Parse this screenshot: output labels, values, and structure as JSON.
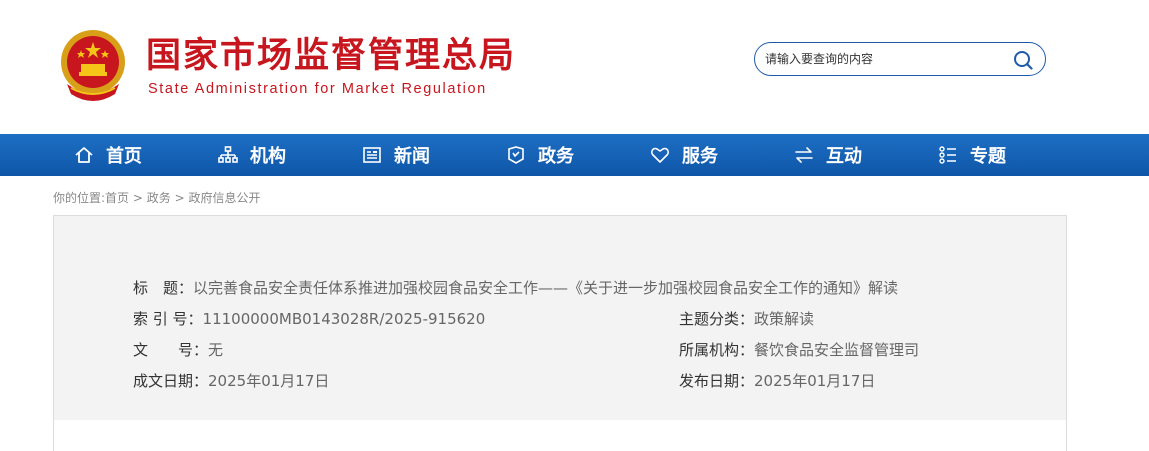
{
  "header": {
    "title": "国家市场监督管理总局",
    "subtitle": "State Administration for Market Regulation",
    "search_placeholder": "请输入要查询的内容"
  },
  "nav": {
    "items": [
      {
        "label": "首页",
        "icon": "home-icon"
      },
      {
        "label": "机构",
        "icon": "org-chart-icon"
      },
      {
        "label": "新闻",
        "icon": "news-icon"
      },
      {
        "label": "政务",
        "icon": "government-affairs-icon"
      },
      {
        "label": "服务",
        "icon": "heart-icon"
      },
      {
        "label": "互动",
        "icon": "exchange-arrows-icon"
      },
      {
        "label": "专题",
        "icon": "topics-icon"
      }
    ]
  },
  "breadcrumb": {
    "prefix": "你的位置:",
    "items": [
      "首页",
      "政务",
      "政府信息公开"
    ],
    "separator": ">"
  },
  "info": {
    "title_label": "标　题：",
    "title_value": "以完善食品安全责任体系推进加强校园食品安全工作——《关于进一步加强校园食品安全工作的通知》解读",
    "index_label": "索 引 号：",
    "index_value": "11100000MB0143028R/2025-915620",
    "topic_label": "主题分类：",
    "topic_value": "政策解读",
    "doc_label": "文　　号：",
    "doc_value": "无",
    "org_label": "所属机构：",
    "org_value": "餐饮食品安全监督管理司",
    "created_label": "成文日期：",
    "created_value": "2025年01月17日",
    "published_label": "发布日期：",
    "published_value": "2025年01月17日"
  },
  "colors": {
    "brand_red": "#c8161e",
    "nav_blue": "#1565b8"
  }
}
